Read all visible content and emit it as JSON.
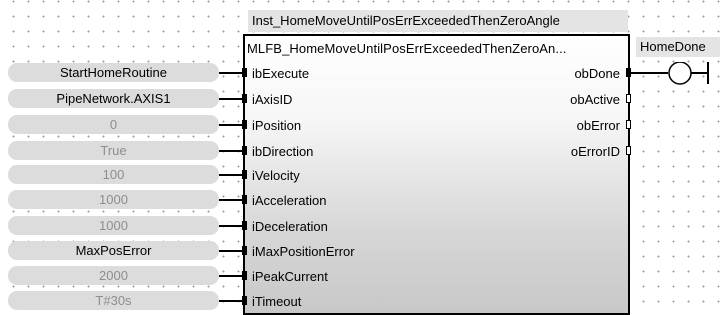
{
  "block": {
    "instance_name": "Inst_HomeMoveUntilPosErrExceededThenZeroAngle",
    "type_name": "MLFB_HomeMoveUntilPosErrExceededThenZeroAn..."
  },
  "inputs": [
    {
      "pin": "ibExecute",
      "value": "StartHomeRoutine",
      "dim": false
    },
    {
      "pin": "iAxisID",
      "value": "PipeNetwork.AXIS1",
      "dim": false
    },
    {
      "pin": "iPosition",
      "value": "0",
      "dim": true
    },
    {
      "pin": "ibDirection",
      "value": "True",
      "dim": true
    },
    {
      "pin": "iVelocity",
      "value": "100",
      "dim": true
    },
    {
      "pin": "iAcceleration",
      "value": "1000",
      "dim": true
    },
    {
      "pin": "iDeceleration",
      "value": "1000",
      "dim": true
    },
    {
      "pin": "iMaxPositionError",
      "value": "MaxPosError",
      "dim": false
    },
    {
      "pin": "iPeakCurrent",
      "value": "2000",
      "dim": true
    },
    {
      "pin": "iTimeout",
      "value": "T#30s",
      "dim": true
    }
  ],
  "outputs": [
    {
      "pin": "obDone",
      "connected": true
    },
    {
      "pin": "obActive",
      "connected": false
    },
    {
      "pin": "obError",
      "connected": false
    },
    {
      "pin": "oErrorID",
      "connected": false
    }
  ],
  "coil": {
    "variable": "HomeDone"
  }
}
